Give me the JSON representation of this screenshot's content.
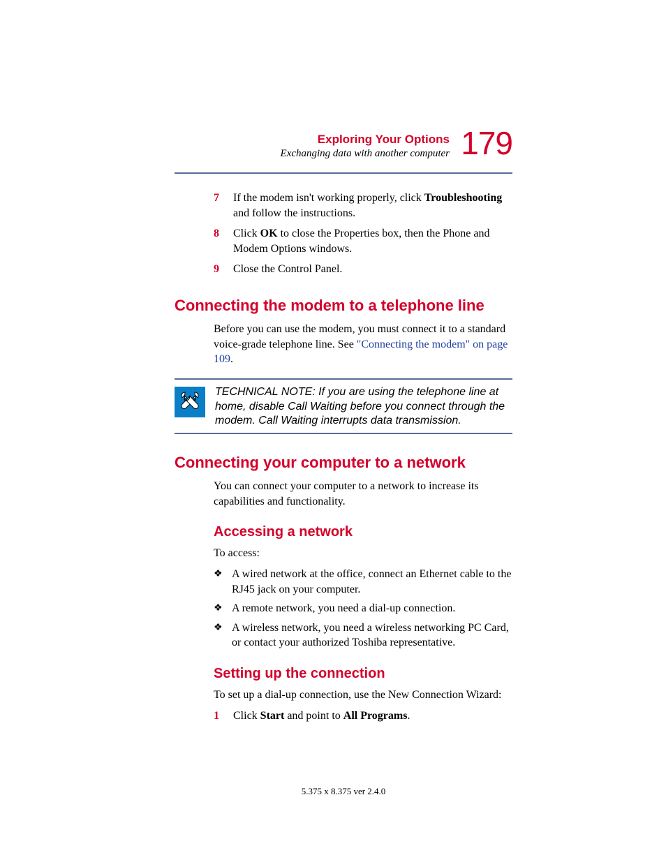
{
  "header": {
    "chapter": "Exploring Your Options",
    "section": "Exchanging data with another computer",
    "page_number": "179"
  },
  "steps_top": [
    {
      "num": "7",
      "pre": "If the modem isn't working properly, click ",
      "bold": "Troubleshooting",
      "post": " and follow the instructions."
    },
    {
      "num": "8",
      "pre": "Click ",
      "bold": "OK",
      "post": " to close the Properties box, then the Phone and Modem Options windows."
    },
    {
      "num": "9",
      "pre": "Close the Control Panel.",
      "bold": "",
      "post": ""
    }
  ],
  "sec1": {
    "heading": "Connecting the modem to a telephone line",
    "para_pre": "Before you can use the modem, you must connect it to a standard voice-grade telephone line. See ",
    "link": "\"Connecting the modem\" on page 109",
    "para_post": "."
  },
  "note": {
    "label": "TECHNICAL NOTE: ",
    "text": "If you are using the telephone line at home, disable Call Waiting before you connect through the modem. Call Waiting interrupts data transmission."
  },
  "sec2": {
    "heading": "Connecting your computer to a network",
    "para": "You can connect your computer to a network to increase its capabilities and functionality."
  },
  "sec3": {
    "heading": "Accessing a network",
    "intro": "To access:",
    "bullets": [
      "A wired network at the office, connect an Ethernet cable to the RJ45 jack on your computer.",
      "A remote network, you need a dial-up connection.",
      "A wireless network, you need a wireless networking PC Card, or contact your authorized Toshiba representative."
    ]
  },
  "sec4": {
    "heading": "Setting up the connection",
    "intro": "To set up a dial-up connection, use the New Connection Wizard:",
    "step": {
      "num": "1",
      "pre": "Click ",
      "b1": "Start",
      "mid": " and point to ",
      "b2": "All Programs",
      "post": "."
    }
  },
  "footer": "5.375 x 8.375 ver 2.4.0"
}
